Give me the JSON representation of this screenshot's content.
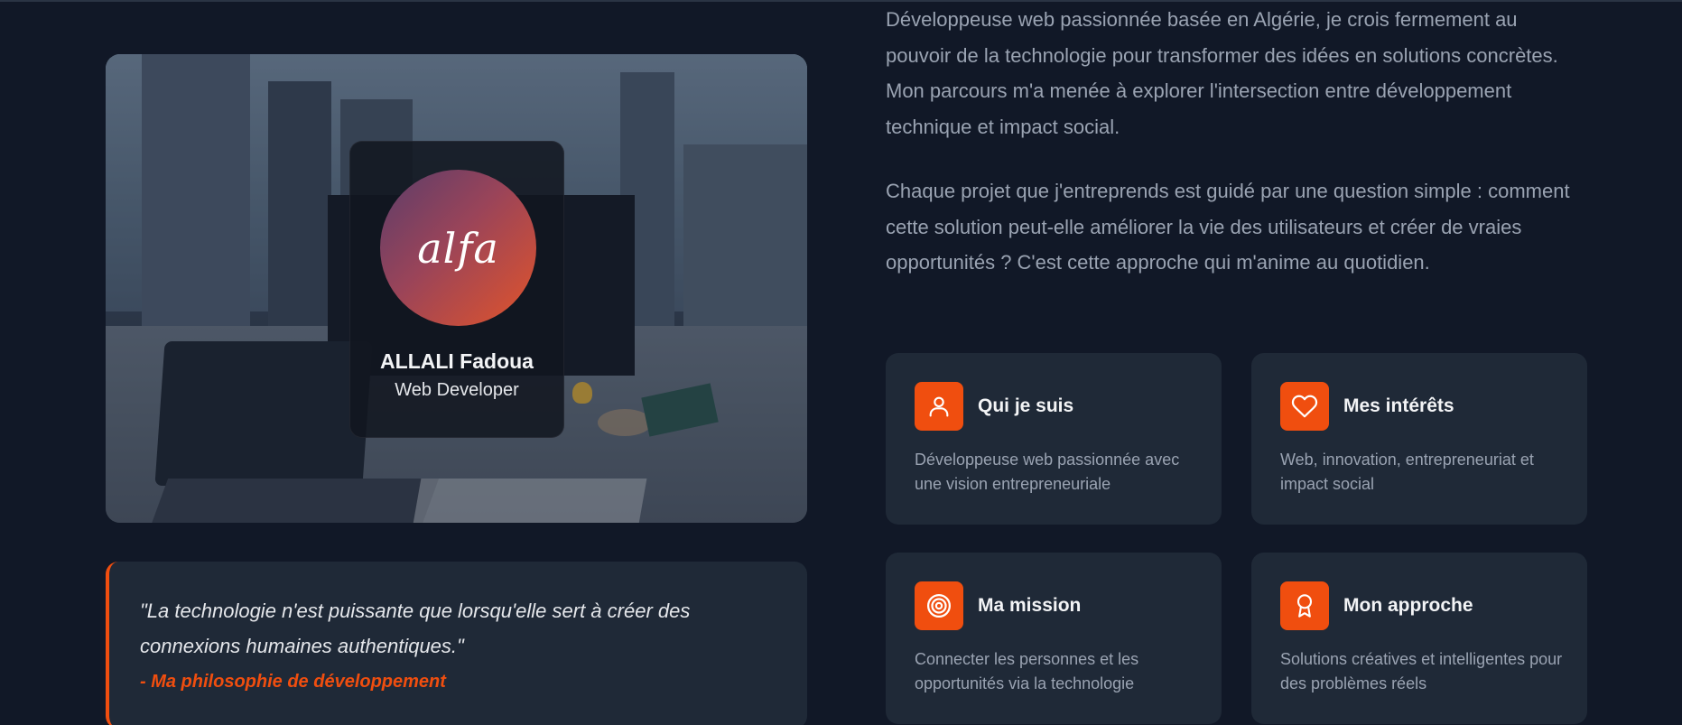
{
  "profile": {
    "logo_text": "alfa",
    "name": "ALLALI Fadoua",
    "role": "Web Developer"
  },
  "quote": {
    "text": "\"La technologie n'est puissante que lorsqu'elle sert à créer des connexions humaines authentiques.\"",
    "signature": "- Ma philosophie de développement"
  },
  "about": {
    "paragraph1": "Développeuse web passionnée basée en Algérie, je crois fermement au pouvoir de la technologie pour transformer des idées en solutions concrètes. Mon parcours m'a menée à explorer l'intersection entre développement technique et impact social.",
    "paragraph2": "Chaque projet que j'entreprends est guidé par une question simple : comment cette solution peut-elle améliorer la vie des utilisateurs et créer de vraies opportunités ? C'est cette approche qui m'anime au quotidien."
  },
  "cards": [
    {
      "icon": "user-icon",
      "title": "Qui je suis",
      "description": "Développeuse web passionnée avec une vision entrepreneuriale"
    },
    {
      "icon": "heart-icon",
      "title": "Mes intérêts",
      "description": "Web, innovation, entrepreneuriat et impact social"
    },
    {
      "icon": "target-icon",
      "title": "Ma mission",
      "description": "Connecter les personnes et les opportunités via la technologie"
    },
    {
      "icon": "award-icon",
      "title": "Mon approche",
      "description": "Solutions créatives et intelligentes pour des problèmes réels"
    }
  ],
  "colors": {
    "background": "#111827",
    "card": "#1f2937",
    "accent": "#f04e0f",
    "muted_text": "#9aa3b2"
  }
}
